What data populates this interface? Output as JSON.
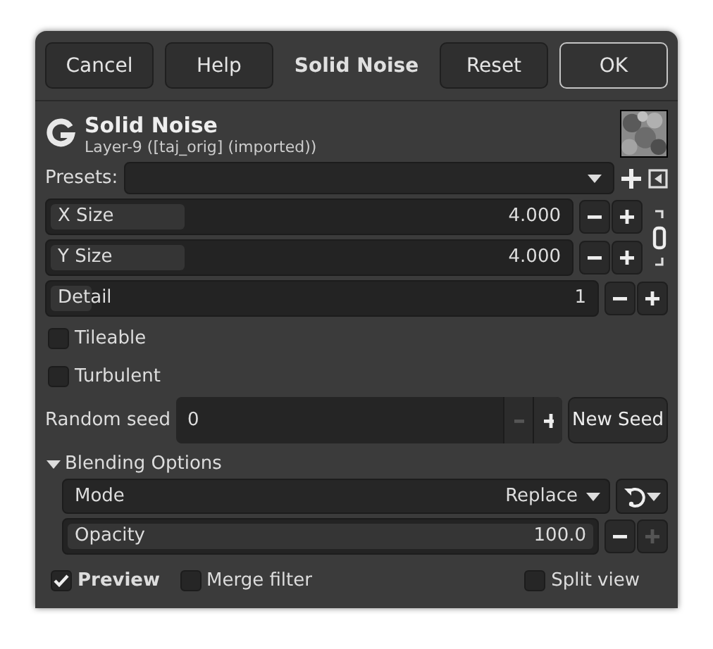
{
  "header_buttons": [
    {
      "label": "Cancel",
      "kind": "button",
      "default": false
    },
    {
      "label": "Help",
      "kind": "button",
      "default": false
    },
    {
      "label": "Solid Noise",
      "kind": "title"
    },
    {
      "label": "Reset",
      "kind": "button",
      "default": false
    },
    {
      "label": "OK",
      "kind": "button",
      "default": true
    }
  ],
  "filter": {
    "title": "Solid Noise",
    "subtitle": "Layer-9 ([taj_orig] (imported))"
  },
  "presets": {
    "label": "Presets:"
  },
  "size_sliders": [
    {
      "label": "X Size",
      "value": "4.000",
      "level": 0.27
    },
    {
      "label": "Y Size",
      "value": "4.000",
      "level": 0.27
    }
  ],
  "chain": {
    "linked": true
  },
  "detail": {
    "label": "Detail",
    "value": "1",
    "level": 0.09
  },
  "options": [
    {
      "label": "Tileable",
      "checked": false
    },
    {
      "label": "Turbulent",
      "checked": false
    }
  ],
  "seed": {
    "label": "Random seed",
    "value": "0",
    "minus_disabled": true,
    "plus_disabled": false,
    "button": "New Seed"
  },
  "blending": {
    "label": "Blending Options",
    "expanded": true,
    "mode_label": "Mode",
    "mode_value": "Replace",
    "opacity": {
      "label": "Opacity",
      "value": "100.0",
      "level": 1,
      "minus_disabled": false,
      "plus_disabled": true
    }
  },
  "footer": [
    {
      "label": "Preview",
      "checked": true
    },
    {
      "label": "Merge filter",
      "checked": false
    },
    {
      "label": "Split view",
      "checked": false
    }
  ]
}
